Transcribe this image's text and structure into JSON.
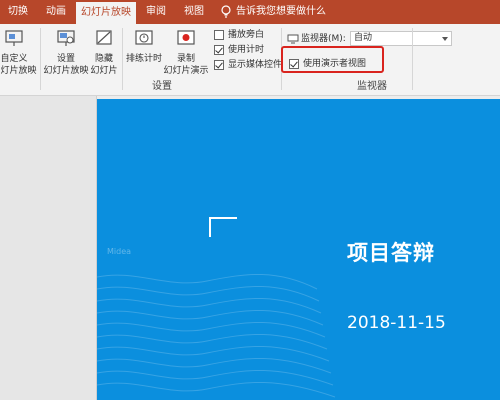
{
  "tabs": [
    {
      "label": "切换",
      "active": false
    },
    {
      "label": "动画",
      "active": false
    },
    {
      "label": "幻灯片放映",
      "active": true
    },
    {
      "label": "审阅",
      "active": false
    },
    {
      "label": "视图",
      "active": false
    }
  ],
  "tell_me": "告诉我您想要做什么",
  "ribbon": {
    "custom_show": {
      "line1": "自定义",
      "line2": "幻灯片放映"
    },
    "setup_show": {
      "line1": "设置",
      "line2": "幻灯片放映"
    },
    "hide_slide": {
      "line1": "隐藏",
      "line2": "幻灯片"
    },
    "rehearse": {
      "line1": "排练计时",
      "line2": ""
    },
    "record": {
      "line1": "录制",
      "line2": "幻灯片演示"
    },
    "checkboxes": [
      {
        "label": "播放旁白",
        "checked": false
      },
      {
        "label": "使用计时",
        "checked": true
      },
      {
        "label": "显示媒体控件",
        "checked": true
      }
    ],
    "setup_group_label": "设置",
    "monitor": {
      "label": "监视器(M):",
      "value": "自动",
      "presenter_view_label": "使用演示者视图",
      "presenter_view_checked": true,
      "group_label": "监视器"
    }
  },
  "slide": {
    "title": "项目答辩",
    "date": "2018-11-15",
    "watermark": "Midea",
    "background_color": "#0b8fde"
  },
  "colors": {
    "accent": "#b7472a",
    "highlight": "#d9241e"
  }
}
